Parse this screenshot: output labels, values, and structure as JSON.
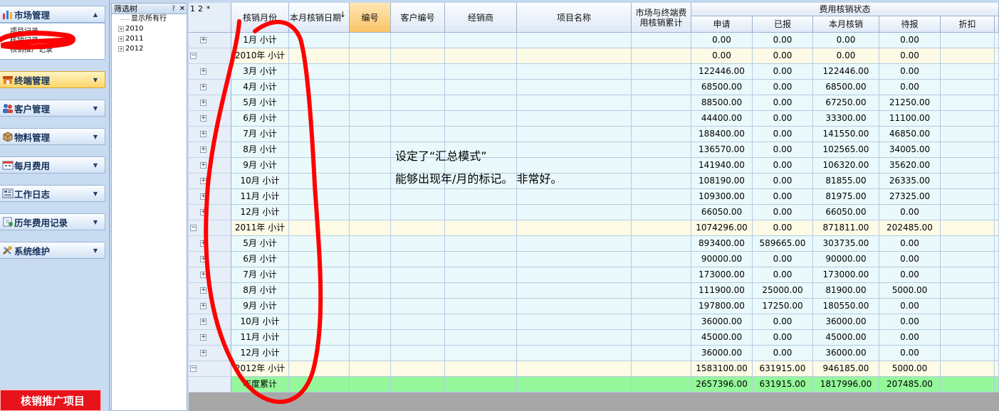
{
  "nav": {
    "sections": [
      {
        "label": "市场管理",
        "icon": "bar-chart-icon"
      },
      {
        "label": "终端管理",
        "icon": "store-icon"
      },
      {
        "label": "客户管理",
        "icon": "users-icon"
      },
      {
        "label": "物料管理",
        "icon": "box-icon"
      },
      {
        "label": "每月费用",
        "icon": "calendar-icon"
      },
      {
        "label": "工作日志",
        "icon": "log-icon"
      },
      {
        "label": "历年费用记录",
        "icon": "history-icon"
      },
      {
        "label": "系统维护",
        "icon": "tools-icon"
      }
    ],
    "sub_items": [
      "项目记录",
      "核销记录",
      "核销推广记录"
    ],
    "promo_label": "核销推广项目"
  },
  "tree": {
    "title": "筛选树",
    "pin_glyph": "ᚹ",
    "close_glyph": "✕",
    "root": "显示所有行",
    "nodes": [
      "2010",
      "2011",
      "2012"
    ]
  },
  "grid": {
    "levels": [
      "1",
      "2",
      "*"
    ],
    "columns": {
      "month": "核销月份",
      "date": "本月核销日期",
      "sort_glyph": "↓",
      "code": "编号",
      "client_code": "客户编号",
      "dealer": "经销商",
      "project": "项目名称",
      "cumulative": "市场与终端费用核销累计",
      "status_group": "费用核销状态",
      "apply": "申请",
      "reported": "已报",
      "verified": "本月核销",
      "pending": "待报",
      "discount": "折扣"
    },
    "rows": [
      {
        "type": "leaf",
        "month": "1月  小计",
        "apply": "0.00",
        "reported": "0.00",
        "verified": "0.00",
        "pending": "0.00"
      },
      {
        "type": "year",
        "month": "2010年  小计",
        "apply": "0.00",
        "reported": "0.00",
        "verified": "0.00",
        "pending": "0.00"
      },
      {
        "type": "leaf",
        "month": "3月  小计",
        "apply": "122446.00",
        "reported": "0.00",
        "verified": "122446.00",
        "pending": "0.00"
      },
      {
        "type": "leaf",
        "month": "4月  小计",
        "apply": "68500.00",
        "reported": "0.00",
        "verified": "68500.00",
        "pending": "0.00"
      },
      {
        "type": "leaf",
        "month": "5月  小计",
        "apply": "88500.00",
        "reported": "0.00",
        "verified": "67250.00",
        "pending": "21250.00"
      },
      {
        "type": "leaf",
        "month": "6月  小计",
        "apply": "44400.00",
        "reported": "0.00",
        "verified": "33300.00",
        "pending": "11100.00"
      },
      {
        "type": "leaf",
        "month": "7月  小计",
        "apply": "188400.00",
        "reported": "0.00",
        "verified": "141550.00",
        "pending": "46850.00"
      },
      {
        "type": "leaf",
        "month": "8月  小计",
        "apply": "136570.00",
        "reported": "0.00",
        "verified": "102565.00",
        "pending": "34005.00"
      },
      {
        "type": "leaf",
        "month": "9月  小计",
        "apply": "141940.00",
        "reported": "0.00",
        "verified": "106320.00",
        "pending": "35620.00"
      },
      {
        "type": "leaf",
        "month": "10月  小计",
        "apply": "108190.00",
        "reported": "0.00",
        "verified": "81855.00",
        "pending": "26335.00"
      },
      {
        "type": "leaf",
        "month": "11月  小计",
        "apply": "109300.00",
        "reported": "0.00",
        "verified": "81975.00",
        "pending": "27325.00"
      },
      {
        "type": "leaf",
        "month": "12月  小计",
        "apply": "66050.00",
        "reported": "0.00",
        "verified": "66050.00",
        "pending": "0.00"
      },
      {
        "type": "year",
        "month": "2011年  小计",
        "apply": "1074296.00",
        "reported": "0.00",
        "verified": "871811.00",
        "pending": "202485.00"
      },
      {
        "type": "leaf",
        "month": "5月  小计",
        "apply": "893400.00",
        "reported": "589665.00",
        "verified": "303735.00",
        "pending": "0.00"
      },
      {
        "type": "leaf",
        "month": "6月  小计",
        "apply": "90000.00",
        "reported": "0.00",
        "verified": "90000.00",
        "pending": "0.00"
      },
      {
        "type": "leaf",
        "month": "7月  小计",
        "apply": "173000.00",
        "reported": "0.00",
        "verified": "173000.00",
        "pending": "0.00"
      },
      {
        "type": "leaf",
        "month": "8月  小计",
        "apply": "111900.00",
        "reported": "25000.00",
        "verified": "81900.00",
        "pending": "5000.00"
      },
      {
        "type": "leaf",
        "month": "9月  小计",
        "apply": "197800.00",
        "reported": "17250.00",
        "verified": "180550.00",
        "pending": "0.00"
      },
      {
        "type": "leaf",
        "month": "10月  小计",
        "apply": "36000.00",
        "reported": "0.00",
        "verified": "36000.00",
        "pending": "0.00"
      },
      {
        "type": "leaf",
        "month": "11月  小计",
        "apply": "45000.00",
        "reported": "0.00",
        "verified": "45000.00",
        "pending": "0.00"
      },
      {
        "type": "leaf",
        "month": "12月  小计",
        "apply": "36000.00",
        "reported": "0.00",
        "verified": "36000.00",
        "pending": "0.00"
      },
      {
        "type": "year",
        "month": "2012年  小计",
        "apply": "1583100.00",
        "reported": "631915.00",
        "verified": "946185.00",
        "pending": "5000.00"
      },
      {
        "type": "total",
        "month": "年度累计",
        "apply": "2657396.00",
        "reported": "631915.00",
        "verified": "1817996.00",
        "pending": "207485.00"
      }
    ]
  },
  "annotation": {
    "line1": "设定了“汇总模式”",
    "line2": "能够出现年/月的标记。 非常好。",
    "color": "#ff0000"
  }
}
